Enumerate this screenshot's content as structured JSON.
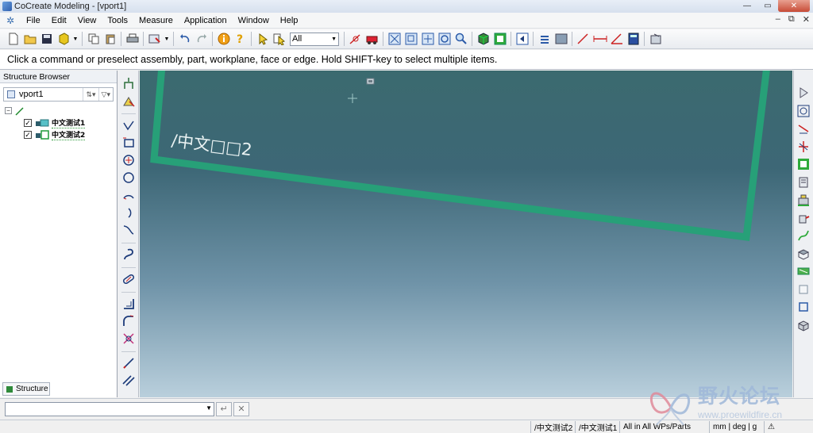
{
  "window": {
    "title": "CoCreate Modeling - [vport1]",
    "min": "—",
    "max": "▭",
    "close": "✕"
  },
  "menu": [
    {
      "label": "File"
    },
    {
      "label": "Edit"
    },
    {
      "label": "View"
    },
    {
      "label": "Tools"
    },
    {
      "label": "Measure"
    },
    {
      "label": "Application"
    },
    {
      "label": "Window"
    },
    {
      "label": "Help"
    }
  ],
  "mdi_controls": {
    "min": "–",
    "restore": "⧉",
    "close": "✕"
  },
  "toolbar": {
    "filter_value": "All"
  },
  "prompt": "Click a command or preselect assembly, part, workplane, face or edge. Hold SHIFT-key to select multiple items.",
  "browser": {
    "title": "Structure Browser",
    "viewport": "vport1",
    "tree_root_expander": "⊟",
    "items": [
      {
        "label": "中文测试1",
        "checked": "✓"
      },
      {
        "label": "中文测试2",
        "checked": "✓"
      }
    ],
    "tab": "Structure"
  },
  "viewport": {
    "workplane_label": "/中文□□2",
    "colors": {
      "frame": "#27a078",
      "label": "#e9f2f2"
    }
  },
  "statusbar": {
    "wp1": "/中文测试2",
    "wp2": "/中文测试1",
    "filter": "All in All WPs/Parts",
    "units": "mm | deg | g"
  },
  "watermark": {
    "text": "野火论坛",
    "url": "www.proewildfire.cn"
  }
}
